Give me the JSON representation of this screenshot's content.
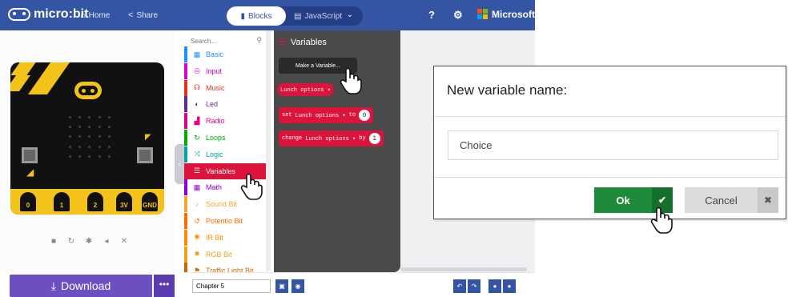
{
  "topbar": {
    "brand": "micro:bit",
    "home_label": "Home",
    "share_label": "Share",
    "tabs": {
      "blocks": "Blocks",
      "javascript": "JavaScript"
    },
    "microsoft_label": "Microsoft"
  },
  "simulator": {
    "pins": [
      "0",
      "1",
      "2",
      "3V",
      "GND"
    ],
    "controls": [
      "■",
      "↻",
      "✱",
      "◂",
      "✕"
    ]
  },
  "download": {
    "label": "Download",
    "more": "•••"
  },
  "toolbox": {
    "search_placeholder": "Search...",
    "categories": [
      {
        "label": "Basic",
        "icon": "grid-icon",
        "color": "#1e90ff"
      },
      {
        "label": "Input",
        "icon": "target-icon",
        "color": "#d400d4"
      },
      {
        "label": "Music",
        "icon": "headphones-icon",
        "color": "#e63022"
      },
      {
        "label": "Led",
        "icon": "toggle-icon",
        "color": "#5c2d91"
      },
      {
        "label": "Radio",
        "icon": "signal-icon",
        "color": "#e3008c"
      },
      {
        "label": "Loops",
        "icon": "loop-icon",
        "color": "#00aa00"
      },
      {
        "label": "Logic",
        "icon": "shuffle-icon",
        "color": "#00a4a6"
      },
      {
        "label": "Variables",
        "icon": "list-icon",
        "color": "#dc143c"
      },
      {
        "label": "Math",
        "icon": "calculator-icon",
        "color": "#9400d3"
      },
      {
        "label": "Sound Bit",
        "icon": "mic-icon",
        "color": "#f3a52e"
      },
      {
        "label": "Potentio Bit",
        "icon": "refresh-icon",
        "color": "#ff6d00"
      },
      {
        "label": "IR Bit",
        "icon": "sun-icon",
        "color": "#ff8c00"
      },
      {
        "label": "RGB Bit",
        "icon": "rgb-icon",
        "color": "#e8a317"
      },
      {
        "label": "Traffic Light Bit",
        "icon": "traffic-icon",
        "color": "#c76a00"
      }
    ]
  },
  "flyout": {
    "heading": "Variables",
    "make_variable": "Make a Variable...",
    "variable_block": "Lunch options ▾",
    "set_block": {
      "keyword": "set",
      "variable": "Lunch options ▾",
      "to": "to",
      "value": "0"
    },
    "change_block": {
      "keyword": "change",
      "variable": "Lunch options ▾",
      "by": "by",
      "value": "1"
    }
  },
  "bottombar": {
    "project_name": "Chapter 5"
  },
  "dialog": {
    "title": "New variable name:",
    "input_value": "Choice",
    "ok_label": "Ok",
    "cancel_label": "Cancel"
  }
}
